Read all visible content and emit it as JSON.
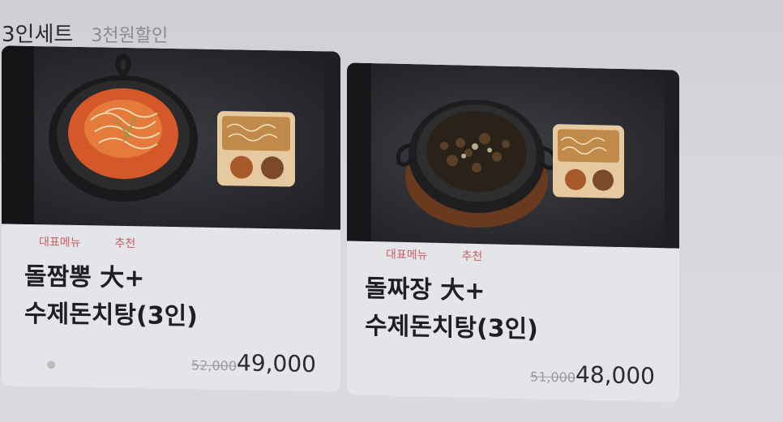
{
  "section": {
    "title": "3인세트",
    "subtitle": "3천원할인"
  },
  "cards": [
    {
      "tags": [
        "대표메뉴",
        "추천"
      ],
      "name_line1": "돌짬뽕 大+",
      "name_line2": "수제돈치탕(3인)",
      "old_price": "52,000",
      "price": "49,000",
      "photo_icon": "jjamppong-dish-image"
    },
    {
      "tags": [
        "대표메뉴",
        "추천"
      ],
      "name_line1": "돌짜장 大+",
      "name_line2": "수제돈치탕(3인)",
      "old_price": "51,000",
      "price": "48,000",
      "photo_icon": "jjajang-dish-image"
    }
  ]
}
